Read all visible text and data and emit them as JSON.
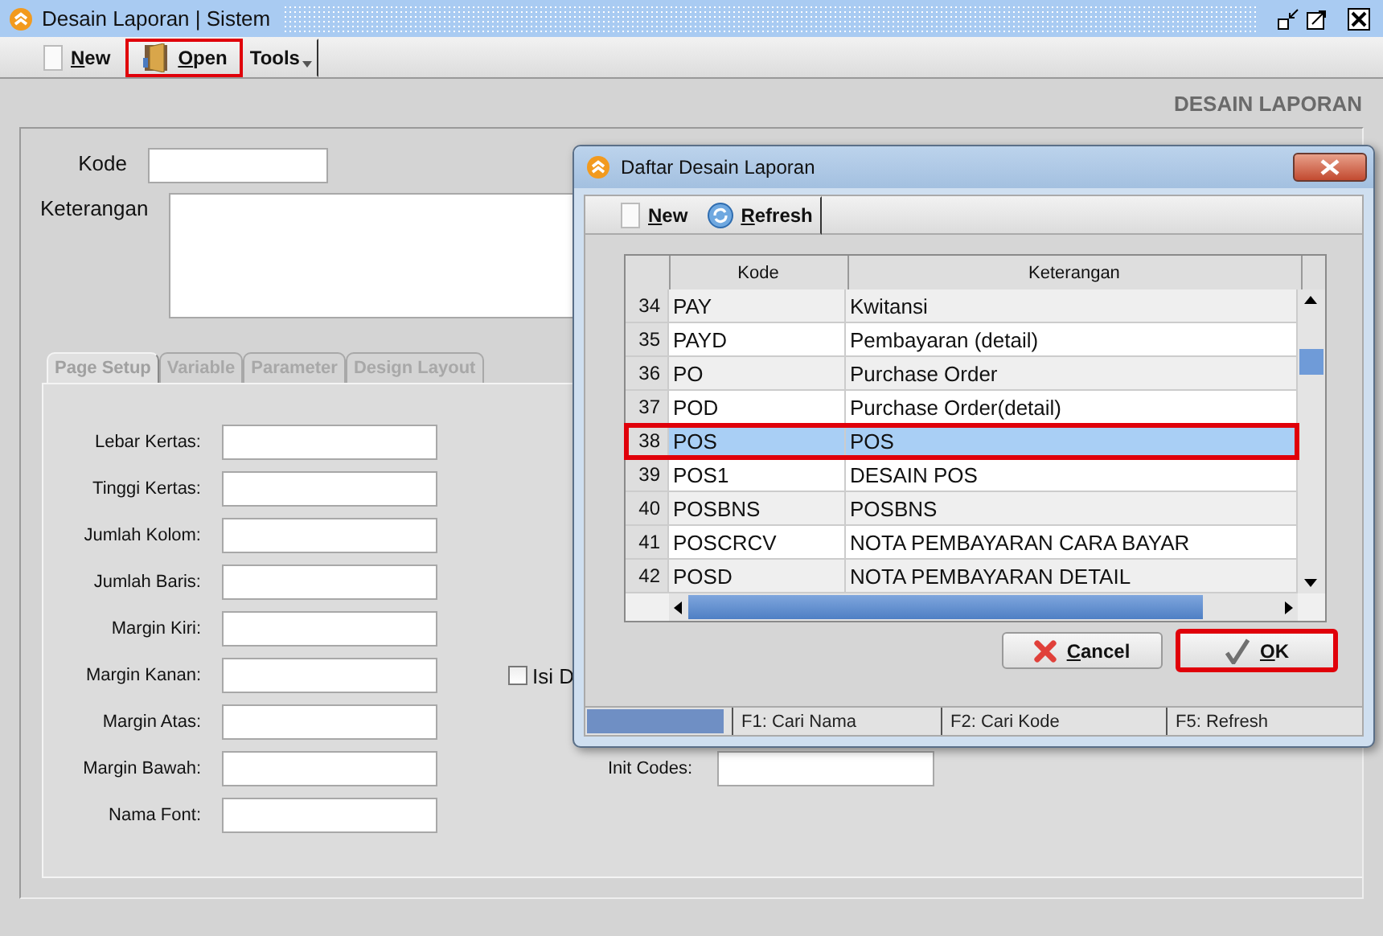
{
  "window": {
    "title": "Desain Laporan | Sistem"
  },
  "toolbar": [
    {
      "kind": "new",
      "label": "New",
      "highlighted": false
    },
    {
      "kind": "open",
      "label": "Open",
      "highlighted": true
    },
    {
      "kind": "menu",
      "label": "Tools",
      "highlighted": false
    }
  ],
  "header": "DESAIN LAPORAN",
  "form": {
    "kode_label": "Kode",
    "keterangan_label": "Keterangan"
  },
  "tabs": [
    {
      "label": "Page Setup",
      "selected": true
    },
    {
      "label": "Variable",
      "selected": false
    },
    {
      "label": "Parameter",
      "selected": false
    },
    {
      "label": "Design Layout",
      "selected": false
    }
  ],
  "page_setup": {
    "fields": [
      {
        "label": "Lebar Kertas:"
      },
      {
        "label": "Tinggi Kertas:"
      },
      {
        "label": "Jumlah Kolom:"
      },
      {
        "label": "Jumlah Baris:"
      },
      {
        "label": "Margin Kiri:"
      },
      {
        "label": "Margin Kanan:"
      },
      {
        "label": "Margin Atas:"
      },
      {
        "label": "Margin Bawah:"
      },
      {
        "label": "Nama Font:"
      }
    ],
    "checkbox": {
      "label": "Isi D",
      "checked": false
    },
    "init_codes_label": "Init Codes:"
  },
  "dialog": {
    "title": "Daftar Desain Laporan",
    "toolbar": [
      {
        "kind": "new",
        "label": "New"
      },
      {
        "kind": "refresh",
        "label": "Refresh"
      }
    ],
    "table": {
      "columns": [
        "Kode",
        "Keterangan"
      ],
      "rows": [
        {
          "number": "34",
          "kode": "PAY",
          "keterangan": "Kwitansi",
          "selected": false
        },
        {
          "number": "35",
          "kode": "PAYD",
          "keterangan": "Pembayaran (detail)",
          "selected": false
        },
        {
          "number": "36",
          "kode": "PO",
          "keterangan": "Purchase Order",
          "selected": false
        },
        {
          "number": "37",
          "kode": "POD",
          "keterangan": "Purchase Order(detail)",
          "selected": false
        },
        {
          "number": "38",
          "kode": "POS",
          "keterangan": "POS",
          "selected": true
        },
        {
          "number": "39",
          "kode": "POS1",
          "keterangan": "DESAIN POS",
          "selected": false
        },
        {
          "number": "40",
          "kode": "POSBNS",
          "keterangan": "POSBNS",
          "selected": false
        },
        {
          "number": "41",
          "kode": "POSCRCV",
          "keterangan": "NOTA PEMBAYARAN CARA BAYAR",
          "selected": false
        },
        {
          "number": "42",
          "kode": "POSD",
          "keterangan": "NOTA PEMBAYARAN DETAIL",
          "selected": false
        }
      ]
    },
    "buttons": [
      {
        "kind": "cancel",
        "label": "Cancel",
        "highlighted": false
      },
      {
        "kind": "ok",
        "label": "OK",
        "highlighted": true
      }
    ],
    "status_bar": [
      "F1: Cari Nama",
      "F2: Cari Kode",
      "F5: Refresh"
    ]
  }
}
